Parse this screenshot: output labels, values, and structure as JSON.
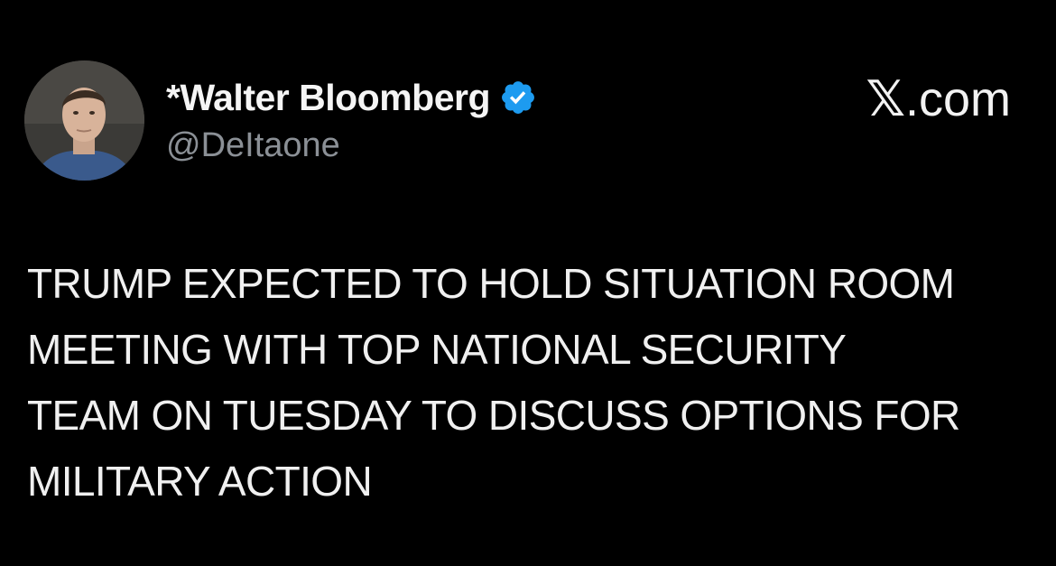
{
  "author": {
    "display_name": "*Walter Bloomberg",
    "handle": "@DeItaone",
    "verified": true,
    "badge_color": "#1d9bf0"
  },
  "brand": {
    "x_glyph": "𝕏",
    "suffix": ".com"
  },
  "tweet": {
    "lines": [
      "TRUMP EXPECTED TO HOLD SITUATION ROOM",
      "MEETING WITH TOP NATIONAL SECURITY",
      "TEAM ON TUESDAY TO DISCUSS OPTIONS FOR",
      "MILITARY ACTION"
    ]
  },
  "colors": {
    "background": "#000000",
    "handle_text": "#8b9096"
  }
}
